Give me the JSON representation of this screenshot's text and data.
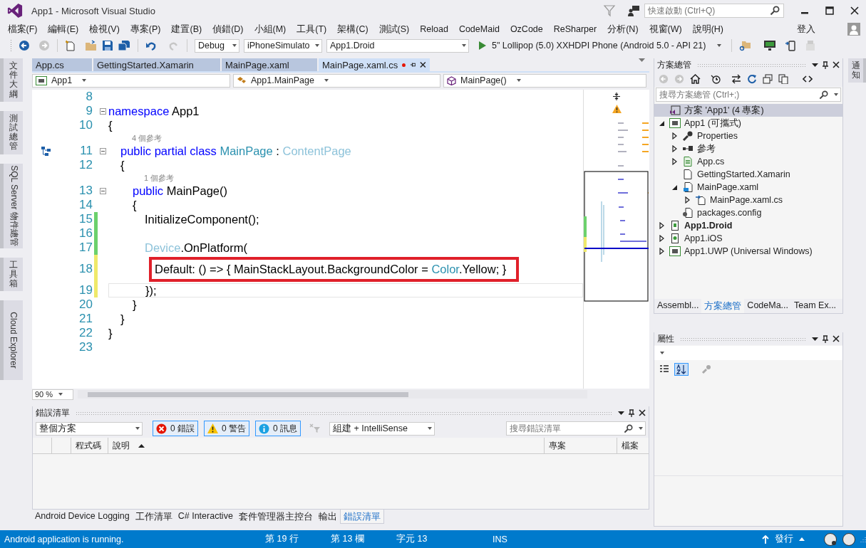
{
  "window": {
    "title": "App1 - Microsoft Visual Studio",
    "quick_launch": {
      "placeholder": "快速啟動 (Ctrl+Q)"
    }
  },
  "menu": [
    "檔案(F)",
    "編輯(E)",
    "檢視(V)",
    "專案(P)",
    "建置(B)",
    "偵錯(D)",
    "小組(M)",
    "工具(T)",
    "架構(C)",
    "測試(S)",
    "Reload",
    "CodeMaid",
    "OzCode",
    "ReSharper",
    "分析(N)",
    "視窗(W)",
    "說明(H)"
  ],
  "sign_in": "登入",
  "toolbar": {
    "configuration": "Debug",
    "platform": "iPhoneSimulato",
    "startup_project": "App1.Droid",
    "run_target": "5\" Lollipop (5.0) XXHDPI Phone (Android 5.0 - API 21)"
  },
  "left_tabs": [
    {
      "label": "文件大綱",
      "kind": "cjk"
    },
    {
      "label": "測試總管",
      "kind": "cjk"
    },
    {
      "label": "SQL Server 物件總管",
      "kind": "latin"
    },
    {
      "label": "工具箱",
      "kind": "cjk"
    },
    {
      "label": "Cloud Explorer",
      "kind": "latin"
    }
  ],
  "editor": {
    "tabs": [
      {
        "label": "App.cs",
        "selected": false,
        "modified": false
      },
      {
        "label": "GettingStarted.Xamarin",
        "selected": false,
        "modified": false
      },
      {
        "label": "MainPage.xaml",
        "selected": false,
        "modified": false
      },
      {
        "label": "MainPage.xaml.cs",
        "selected": true,
        "modified": true
      }
    ],
    "nav": {
      "project": "App1",
      "type": "App1.MainPage",
      "member": "MainPage()"
    },
    "lines": [
      {
        "number": "8"
      },
      {
        "number": "9",
        "fold": true,
        "tokens": [
          {
            "text": "namespace",
            "kind": "keyword"
          },
          {
            "text": " App1",
            "kind": "plain"
          }
        ]
      },
      {
        "number": "10",
        "tokens": [
          {
            "text": "{",
            "kind": "plain"
          }
        ],
        "children": [
          {
            "number": "11",
            "lens": "4 個參考",
            "fold": true,
            "glyph": {
              "kind": "class"
            },
            "tokens": [
              {
                "text": "public partial class",
                "kind": "keyword"
              },
              {
                "text": " MainPage",
                "kind": "type"
              },
              {
                "text": " : ",
                "kind": "plain"
              },
              {
                "text": "ContentPage",
                "kind": "faded"
              }
            ]
          },
          {
            "number": "12",
            "tokens": [
              {
                "text": "{",
                "kind": "plain"
              }
            ],
            "children": [
              {
                "number": "13",
                "lens": "1 個參考",
                "fold": true,
                "tokens": [
                  {
                    "text": "public",
                    "kind": "keyword"
                  },
                  {
                    "text": " MainPage()",
                    "kind": "plain"
                  }
                ]
              },
              {
                "number": "14",
                "tokens": [
                  {
                    "text": "{",
                    "kind": "plain"
                  }
                ],
                "children": [
                  {
                    "number": "15",
                    "change": {
                      "kind": "saved"
                    },
                    "tokens": [
                      {
                        "text": "InitializeComponent();",
                        "kind": "plain"
                      }
                    ]
                  },
                  {
                    "number": "16",
                    "change": {
                      "kind": "saved"
                    }
                  },
                  {
                    "number": "17",
                    "change": {
                      "kind": "saved"
                    },
                    "tokens": [
                      {
                        "text": "Device",
                        "kind": "faded"
                      },
                      {
                        "text": ".OnPlatform(",
                        "kind": "plain"
                      }
                    ]
                  },
                  {
                    "number": "18",
                    "change": {
                      "kind": "unsaved"
                    },
                    "boxed": true,
                    "tokens": [
                      {
                        "text": "Default: () => { MainStackLayout.BackgroundColor = ",
                        "kind": "plain"
                      },
                      {
                        "text": "Color",
                        "kind": "type"
                      },
                      {
                        "text": ".Yellow; }",
                        "kind": "plain"
                      }
                    ]
                  },
                  {
                    "number": "19",
                    "change": {
                      "kind": "unsaved"
                    },
                    "current": true,
                    "tokens": [
                      {
                        "text": "});",
                        "kind": "plain"
                      }
                    ]
                  }
                ]
              },
              {
                "number": "20",
                "tokens": [
                  {
                    "text": "}",
                    "kind": "plain"
                  }
                ]
              }
            ]
          },
          {
            "number": "21",
            "tokens": [
              {
                "text": "}",
                "kind": "plain"
              }
            ]
          }
        ]
      },
      {
        "number": "22",
        "tokens": [
          {
            "text": "}",
            "kind": "plain"
          }
        ]
      },
      {
        "number": "23"
      }
    ],
    "zoom": "90 %"
  },
  "error_list": {
    "title": "錯誤清單",
    "scope": "整個方案",
    "filters": [
      {
        "kind": "error",
        "label": "0 錯誤",
        "selected": true
      },
      {
        "kind": "warning",
        "label": "0 警告",
        "selected": true
      },
      {
        "kind": "info",
        "label": "0 訊息",
        "selected": true
      }
    ],
    "source": "組建 + IntelliSense",
    "search": {
      "placeholder": "搜尋錯誤清單"
    },
    "columns": [
      {
        "label": "程式碼",
        "sorted": false
      },
      {
        "label": "說明",
        "sorted": true
      },
      {
        "label": "專案",
        "sorted": false
      },
      {
        "label": "檔案",
        "sorted": false
      }
    ]
  },
  "bottom_tabs": [
    {
      "label": "Android Device Logging",
      "selected": false
    },
    {
      "label": "工作清單",
      "selected": false
    },
    {
      "label": "C# Interactive",
      "selected": false
    },
    {
      "label": "套件管理器主控台",
      "selected": false
    },
    {
      "label": "輸出",
      "selected": false
    },
    {
      "label": "錯誤清單",
      "selected": true
    }
  ],
  "solution": {
    "title": "方案總管",
    "search": {
      "placeholder": "搜尋方案總管 (Ctrl+;)"
    },
    "tree": [
      {
        "label": "方案 'App1' (4 專案)",
        "kind": "solution",
        "selected": true,
        "bold": false
      },
      {
        "label": "App1 (可攜式)",
        "kind": "csproj",
        "selected": false,
        "bold": false,
        "expanded": true,
        "children": [
          {
            "label": "Properties",
            "kind": "wrench",
            "selected": false,
            "bold": false,
            "expanded": false
          },
          {
            "label": "參考",
            "kind": "references",
            "selected": false,
            "bold": false,
            "expanded": false
          },
          {
            "label": "App.cs",
            "kind": "csfile",
            "selected": false,
            "bold": false,
            "expanded": false
          },
          {
            "label": "GettingStarted.Xamarin",
            "kind": "file",
            "selected": false,
            "bold": false
          },
          {
            "label": "MainPage.xaml",
            "kind": "xaml",
            "selected": false,
            "bold": false,
            "expanded": true,
            "children": [
              {
                "label": "MainPage.xaml.cs",
                "kind": "codefile",
                "selected": false,
                "bold": false,
                "expanded": false
              }
            ]
          },
          {
            "label": "packages.config",
            "kind": "config",
            "selected": false,
            "bold": false
          }
        ]
      },
      {
        "label": "App1.Droid",
        "kind": "android",
        "selected": false,
        "bold": true,
        "expanded": false
      },
      {
        "label": "App1.iOS",
        "kind": "ios",
        "selected": false,
        "bold": false,
        "expanded": false
      },
      {
        "label": "App1.UWP (Universal Windows)",
        "kind": "csproj",
        "selected": false,
        "bold": false,
        "expanded": false
      }
    ],
    "tabs": [
      {
        "label": "Assembl...",
        "selected": false
      },
      {
        "label": "方案總管",
        "selected": true
      },
      {
        "label": "CodeMa...",
        "selected": false
      },
      {
        "label": "Team Ex...",
        "selected": false
      }
    ]
  },
  "properties": {
    "title": "屬性"
  },
  "right_tabs": [
    {
      "label": "通知"
    }
  ],
  "status_bar": {
    "message": "Android application is running.",
    "line": "第 19 行",
    "column": "第 13 欄",
    "char": "字元 13",
    "mode": "INS",
    "publish": "發行"
  }
}
